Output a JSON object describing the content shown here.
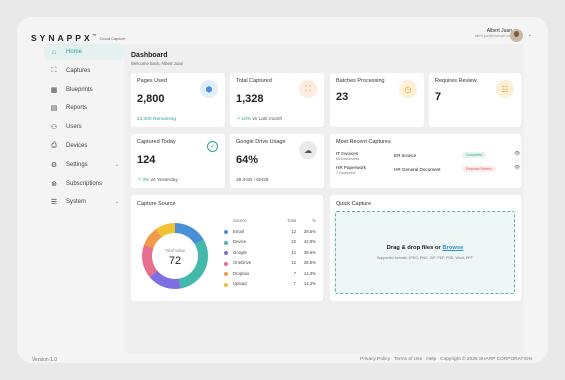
{
  "brand": {
    "name": "SYNAPPX",
    "tm": "™",
    "product": "Cloud Capture"
  },
  "user": {
    "name": "Albert Juan",
    "email": "albert.juan@example.com"
  },
  "nav": [
    {
      "label": "Home",
      "icon": "home-icon",
      "glyph": "⌂",
      "active": true
    },
    {
      "label": "Captures",
      "icon": "capture-icon",
      "glyph": "⛶"
    },
    {
      "label": "Blueprints",
      "icon": "blueprint-icon",
      "glyph": "▦"
    },
    {
      "label": "Reports",
      "icon": "report-icon",
      "glyph": "▤"
    },
    {
      "label": "Users",
      "icon": "users-icon",
      "glyph": "⚇"
    },
    {
      "label": "Devices",
      "icon": "device-icon",
      "glyph": "⎙"
    },
    {
      "label": "Settings",
      "icon": "gear-icon",
      "glyph": "⚙",
      "expand": true
    },
    {
      "label": "Subscriptions",
      "icon": "subscription-icon",
      "glyph": "⊛"
    },
    {
      "label": "System",
      "icon": "sliders-icon",
      "glyph": "☰",
      "expand": true
    }
  ],
  "dashboard": {
    "title": "Dashboard",
    "welcome": "Welcome back, Albert Juan"
  },
  "cards": {
    "pages_used": {
      "title": "Pages Used",
      "value": "2,800",
      "sub": "23,400 Remaining",
      "icon": "cube-icon",
      "glyph": "⬢"
    },
    "total_captured": {
      "title": "Total Captured",
      "value": "1,328",
      "trend": "↗",
      "sub_strong": "10%",
      "sub": "vs Last month",
      "icon": "scan-icon",
      "glyph": "⛶"
    },
    "batches": {
      "title": "Batches Processing",
      "value": "23",
      "icon": "clock-icon",
      "glyph": "◷"
    },
    "review": {
      "title": "Requires Review",
      "value": "7",
      "icon": "list-icon",
      "glyph": "☷"
    },
    "today": {
      "title": "Captured Today",
      "value": "124",
      "trend": "↗",
      "sub_strong": "3%",
      "sub": "vs Yesterday",
      "icon": "check-circle-icon",
      "glyph": "✓"
    },
    "drive": {
      "title": "Google Drive Usage",
      "value": "64%",
      "sub": "38.4GB / 60GB",
      "icon": "cloud-icon",
      "glyph": "☁"
    }
  },
  "recent": {
    "title": "Most Recent Captures",
    "rows": [
      {
        "group": "IT Invoices",
        "count": "65 Documents",
        "doc": "ER Invoice",
        "status": "Completed",
        "kind": "ok"
      },
      {
        "group": "HR Paperwork",
        "count": "1 Document",
        "doc": "HR General Document",
        "status": "Requires Review",
        "kind": "rv"
      }
    ]
  },
  "capture_source": {
    "title": "Capture Source",
    "center_label": "Total Value",
    "center_value": "72",
    "headers": {
      "source": "Source",
      "total": "Total",
      "pct": "%"
    }
  },
  "chart_data": {
    "type": "pie",
    "categories": [
      "Email",
      "Device",
      "Google",
      "OneDrive",
      "Dropbox",
      "Upload"
    ],
    "values": [
      12,
      22,
      12,
      12,
      7,
      7
    ],
    "percents": [
      "28.6%",
      "42.9%",
      "28.6%",
      "28.6%",
      "14.3%",
      "14.3%"
    ],
    "colors": [
      "#4a90d9",
      "#43b9ac",
      "#7d6fe0",
      "#e66f8f",
      "#f29a48",
      "#f2c233"
    ]
  },
  "quick_capture": {
    "title": "Quick Capture",
    "drop_text": "Drag & drop files or",
    "browse": "Browse",
    "formats": "Supported formats: JPEG, PNG, GIF, PDF, PSD, Word, PPT"
  },
  "footer": {
    "version": "Version 1.0",
    "links": [
      "Privacy Policy",
      "Terms of Use",
      "Help"
    ],
    "copyright": "Copyright © 2026 SHARP CORPORATION"
  },
  "colors": {
    "accent": "#2aa39a",
    "link": "#2a8fd6"
  }
}
